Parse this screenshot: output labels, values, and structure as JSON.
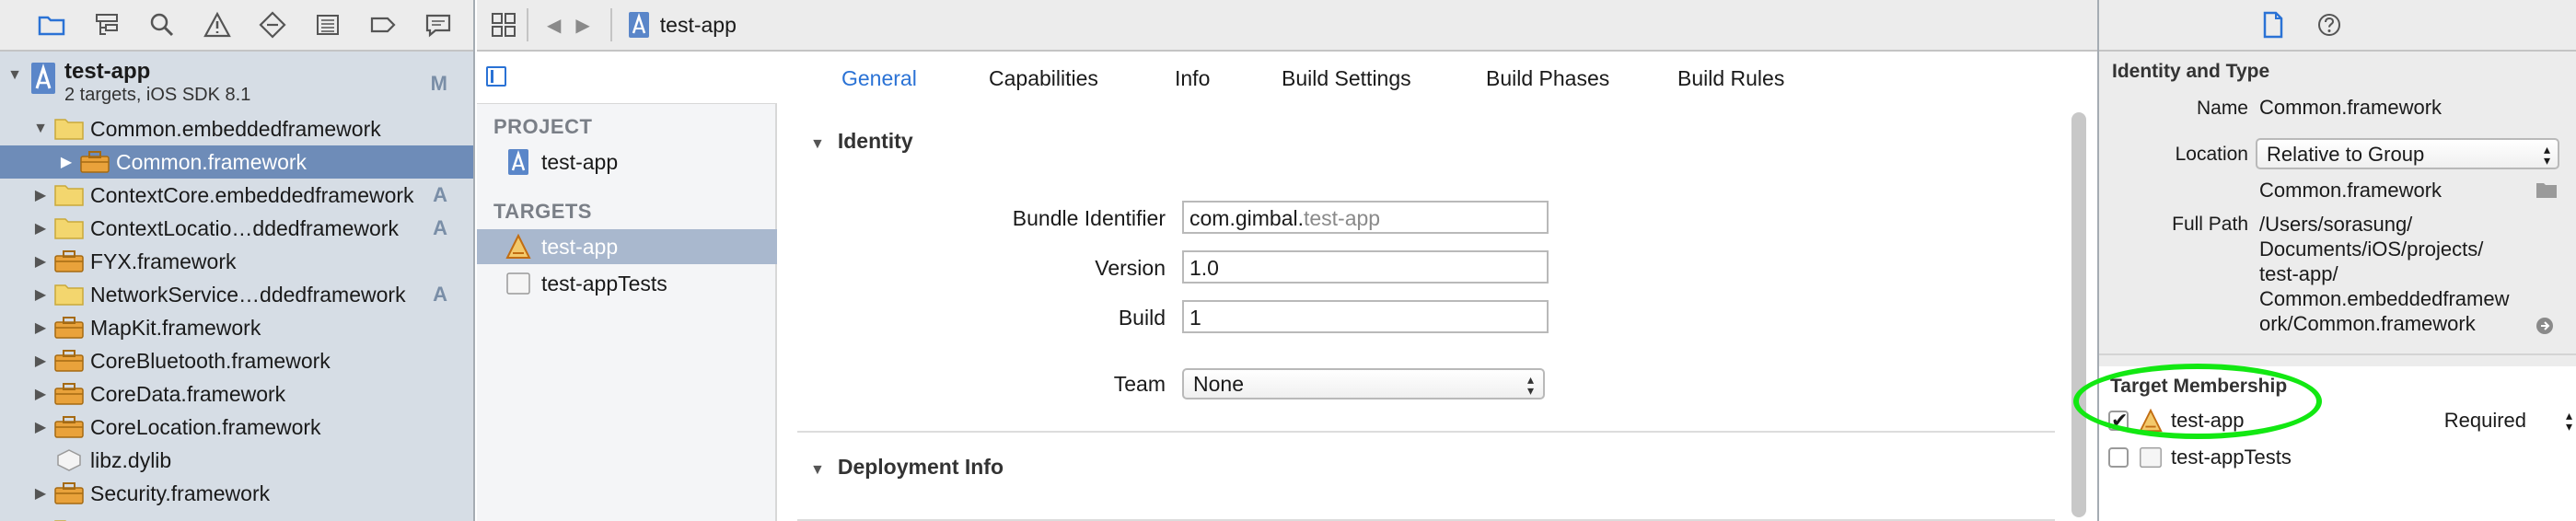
{
  "navigator": {
    "toolbar_icons": [
      "folder-icon",
      "hierarchy-icon",
      "search-icon",
      "warning-icon",
      "breakpoint-diamond-icon",
      "list-icon",
      "tag-icon",
      "speech-bubble-icon"
    ],
    "project": {
      "name": "test-app",
      "subtitle": "2 targets, iOS SDK 8.1",
      "status": "M"
    },
    "items": [
      {
        "label": "Common.embeddedframework",
        "icon": "folder-icon",
        "expanded": true,
        "status": ""
      },
      {
        "label": "Common.framework",
        "icon": "framework-toolbox-icon",
        "expanded": false,
        "status": "",
        "selected": true
      },
      {
        "label": "ContextCore.embeddedframework",
        "icon": "folder-icon",
        "expanded": false,
        "status": "A"
      },
      {
        "label": "ContextLocatio…ddedframework",
        "icon": "folder-icon",
        "expanded": false,
        "status": "A"
      },
      {
        "label": "FYX.framework",
        "icon": "framework-toolbox-icon",
        "expanded": false,
        "status": ""
      },
      {
        "label": "NetworkService…ddedframework",
        "icon": "folder-icon",
        "expanded": false,
        "status": "A"
      },
      {
        "label": "MapKit.framework",
        "icon": "framework-toolbox-icon",
        "expanded": false,
        "status": ""
      },
      {
        "label": "CoreBluetooth.framework",
        "icon": "framework-toolbox-icon",
        "expanded": false,
        "status": ""
      },
      {
        "label": "CoreData.framework",
        "icon": "framework-toolbox-icon",
        "expanded": false,
        "status": ""
      },
      {
        "label": "CoreLocation.framework",
        "icon": "framework-toolbox-icon",
        "expanded": false,
        "status": ""
      },
      {
        "label": "libz.dylib",
        "icon": "dylib-icon",
        "expanded": false,
        "status": ""
      },
      {
        "label": "Security.framework",
        "icon": "framework-toolbox-icon",
        "expanded": false,
        "status": ""
      }
    ]
  },
  "jumpbar": {
    "crumb": "test-app"
  },
  "tabs": [
    "General",
    "Capabilities",
    "Info",
    "Build Settings",
    "Build Phases",
    "Build Rules"
  ],
  "targets_panel": {
    "project_header": "PROJECT",
    "project_item": "test-app",
    "targets_header": "TARGETS",
    "targets": [
      "test-app",
      "test-appTests"
    ]
  },
  "identity": {
    "title": "Identity",
    "bundle_identifier_label": "Bundle Identifier",
    "bundle_identifier_prefix": "com.gimbal.",
    "bundle_identifier_suffix": "test-app",
    "version_label": "Version",
    "version_value": "1.0",
    "build_label": "Build",
    "build_value": "1",
    "team_label": "Team",
    "team_value": "None"
  },
  "deployment": {
    "title": "Deployment Info"
  },
  "inspector": {
    "section_title": "Identity and Type",
    "name_label": "Name",
    "name_value": "Common.framework",
    "location_label": "Location",
    "location_value": "Relative to Group",
    "location_file": "Common.framework",
    "full_path_label": "Full Path",
    "full_path_lines": [
      "/Users/sorasung/",
      "Documents/iOS/projects/",
      "test-app/",
      "Common.embeddedframew",
      "ork/Common.framework"
    ],
    "membership_title": "Target Membership",
    "members": [
      {
        "name": "test-app",
        "checked": true,
        "role": "Required"
      },
      {
        "name": "test-appTests",
        "checked": false,
        "role": ""
      }
    ]
  },
  "colors": {
    "accent": "#2a72d5",
    "selection": "#6e8cb8",
    "highlight": "#12e812"
  }
}
